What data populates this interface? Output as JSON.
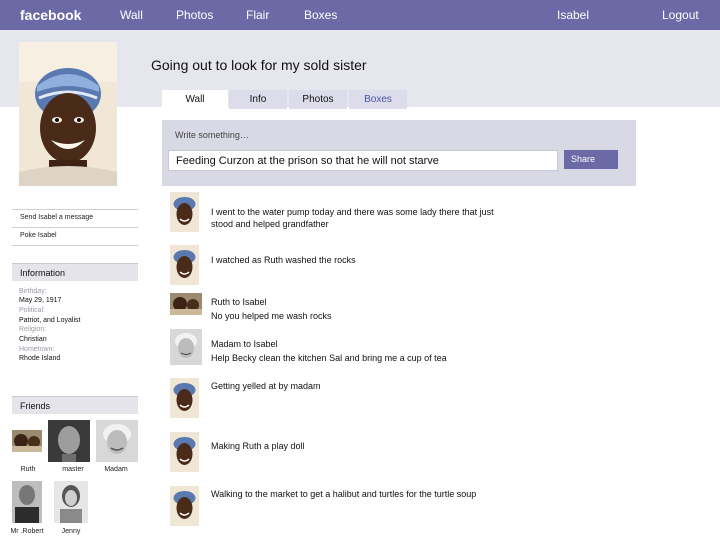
{
  "topbar": {
    "brand": "facebook",
    "nav": [
      "Wall",
      "Photos",
      "Flair",
      "Boxes"
    ],
    "user": "Isabel",
    "logout": "Logout"
  },
  "profile": {
    "headline": "Going out to look for my sold sister"
  },
  "tabs": [
    "Wall",
    "Info",
    "Photos",
    "Boxes"
  ],
  "sidebar": {
    "actions": [
      "Send Isabel a message",
      "Poke Isabel"
    ],
    "information": {
      "heading": "Information",
      "fields": [
        {
          "label": "Birthday:",
          "value": "May 29, 1917"
        },
        {
          "label": "Political:",
          "value": "Patriot,  and Loyalist"
        },
        {
          "label": "Religion:",
          "value": "Christian"
        },
        {
          "label": "Hometown:",
          "value": "Rhode Island"
        }
      ]
    },
    "friends": {
      "heading": "Friends",
      "list": [
        "Ruth",
        "master",
        "Madam",
        "Mr .Robert",
        "Jenny"
      ]
    }
  },
  "composer": {
    "label": "Write something…",
    "value": "Feeding Curzon at the prison so that he will not starve",
    "share": "Share"
  },
  "feed": [
    {
      "lines": [
        "I went to the water pump today and there was some lady there that just",
        "stood and helped grandfather"
      ]
    },
    {
      "lines": [
        "I watched as Ruth washed the rocks"
      ]
    },
    {
      "lines": [
        "Ruth to Isabel",
        "No you helped me wash rocks"
      ]
    },
    {
      "lines": [
        "Madam to Isabel",
        "Help Becky clean the kitchen Sal and bring me a cup of tea"
      ]
    },
    {
      "lines": [
        "Getting yelled at by madam"
      ]
    },
    {
      "lines": [
        "Making Ruth a play doll"
      ]
    },
    {
      "lines": [
        "Walking to the market to get a halibut and turtles for the turtle soup"
      ]
    }
  ],
  "colors": {
    "topbar": "#6b6aa6",
    "band": "#e6e6ee",
    "composer": "#d9d9e6",
    "share_button": "#6b6aa6",
    "boxes_tab_text": "#4b54a6"
  }
}
